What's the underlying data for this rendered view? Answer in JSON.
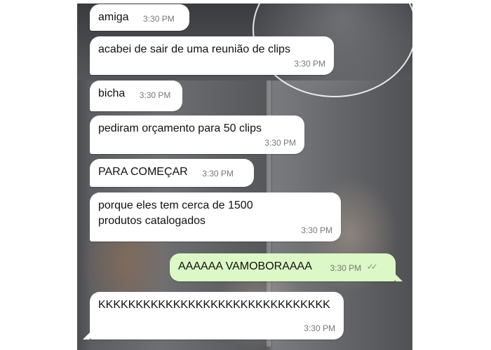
{
  "messages": [
    {
      "text": "amiga",
      "time": "3:30 PM",
      "direction": "incoming"
    },
    {
      "text": "acabei de sair de uma reunião de clips",
      "time": "3:30 PM",
      "direction": "incoming"
    },
    {
      "text": "bicha",
      "time": "3:30 PM",
      "direction": "incoming"
    },
    {
      "text": "pediram orçamento para 50 clips",
      "time": "3:30 PM",
      "direction": "incoming"
    },
    {
      "text": "PARA COMEÇAR",
      "time": "3:30 PM",
      "direction": "incoming"
    },
    {
      "text": "porque eles tem cerca de 1500 produtos catalogados",
      "time": "3:30 PM",
      "direction": "incoming"
    },
    {
      "text": "AAAAAA VAMOBORAAAA",
      "time": "3:30 PM",
      "direction": "outgoing",
      "status_icon": "double-check-icon"
    },
    {
      "text": "KKKKKKKKKKKKKKKKKKKKKKKKKKKKKKK",
      "time": "3:30 PM",
      "direction": "incoming"
    }
  ],
  "colors": {
    "incoming_bubble": "#ffffff",
    "outgoing_bubble": "#dcf8c6",
    "timestamp": "#777777",
    "read_ticks": "#7b9a8f"
  }
}
